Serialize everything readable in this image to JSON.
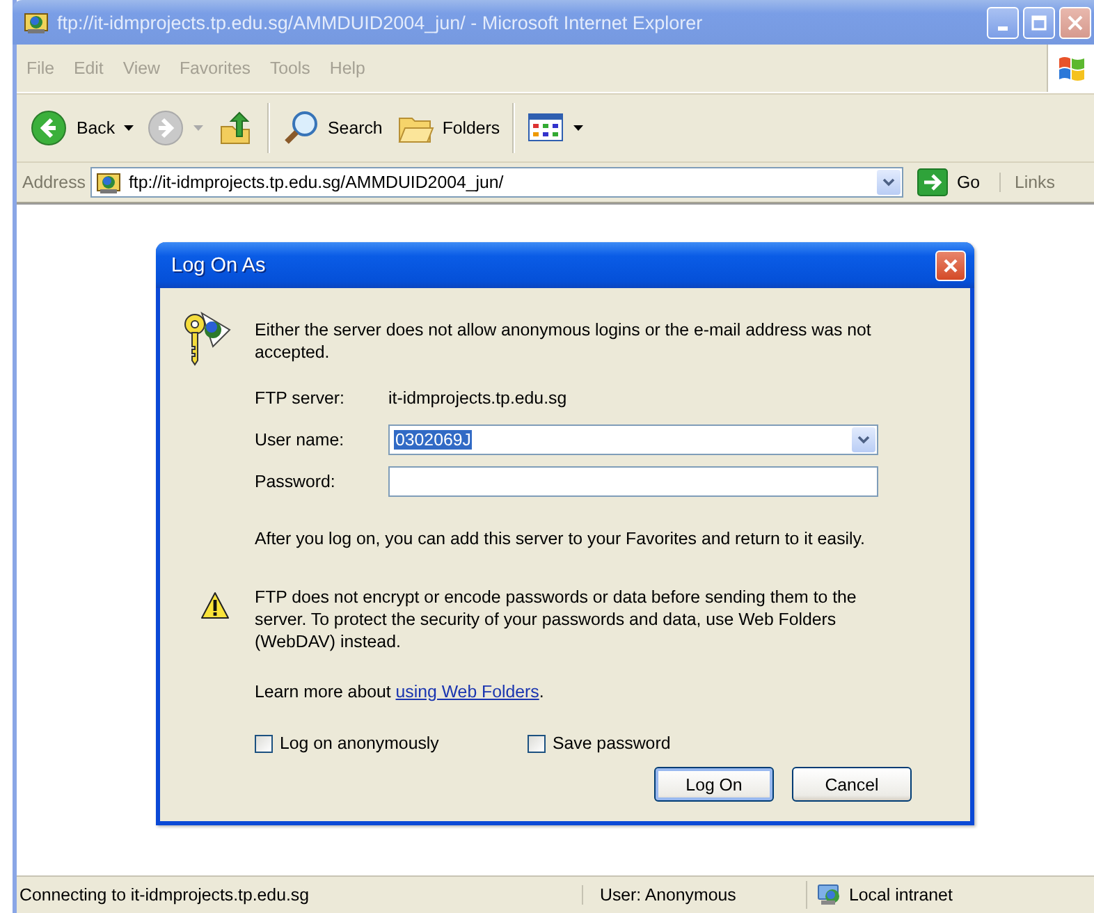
{
  "window": {
    "title": "ftp://it-idmprojects.tp.edu.sg/AMMDUID2004_jun/ - Microsoft Internet Explorer",
    "active": false
  },
  "menu": [
    {
      "label": "File"
    },
    {
      "label": "Edit"
    },
    {
      "label": "View"
    },
    {
      "label": "Favorites"
    },
    {
      "label": "Tools"
    },
    {
      "label": "Help"
    }
  ],
  "toolbar": [
    {
      "kind": "back",
      "label": "Back",
      "disabled": false
    },
    {
      "kind": "forward",
      "disabled": true
    },
    {
      "kind": "up",
      "disabled": false
    },
    {
      "kind": "search",
      "label": "Search",
      "disabled": false
    },
    {
      "kind": "folders",
      "label": "Folders",
      "disabled": false
    },
    {
      "kind": "views",
      "disabled": false
    }
  ],
  "address": {
    "label": "Address",
    "value": "ftp://it-idmprojects.tp.edu.sg/AMMDUID2004_jun/",
    "go": "Go",
    "links": "Links"
  },
  "dialog": {
    "title": "Log On As",
    "message": "Either the server does not allow anonymous logins or the e-mail address was not accepted.",
    "server_label": "FTP server:",
    "server": "it-idmprojects.tp.edu.sg",
    "user_label": "User name:",
    "user_value": "0302069J",
    "user_value_selected": true,
    "password_label": "Password:",
    "info": "After you log on, you can add this server to your Favorites and return to it easily.",
    "warning": "FTP does not encrypt or encode passwords or data before sending them to the server.  To protect the security of your passwords and data, use Web Folders (WebDAV) instead.",
    "learn_more": "Learn more about",
    "link": "using Web Folders",
    "link_after": ".",
    "checkboxes": [
      {
        "label": "Log on anonymously",
        "checked": false
      },
      {
        "label": "Save password",
        "checked": false
      }
    ],
    "buttons": [
      {
        "label": "Log On",
        "default": true
      },
      {
        "label": "Cancel",
        "default": false
      }
    ]
  },
  "status_bar": {
    "message": "Connecting to it-idmprojects.tp.edu.sg",
    "user": "User: Anonymous",
    "zone": "Local intranet"
  }
}
